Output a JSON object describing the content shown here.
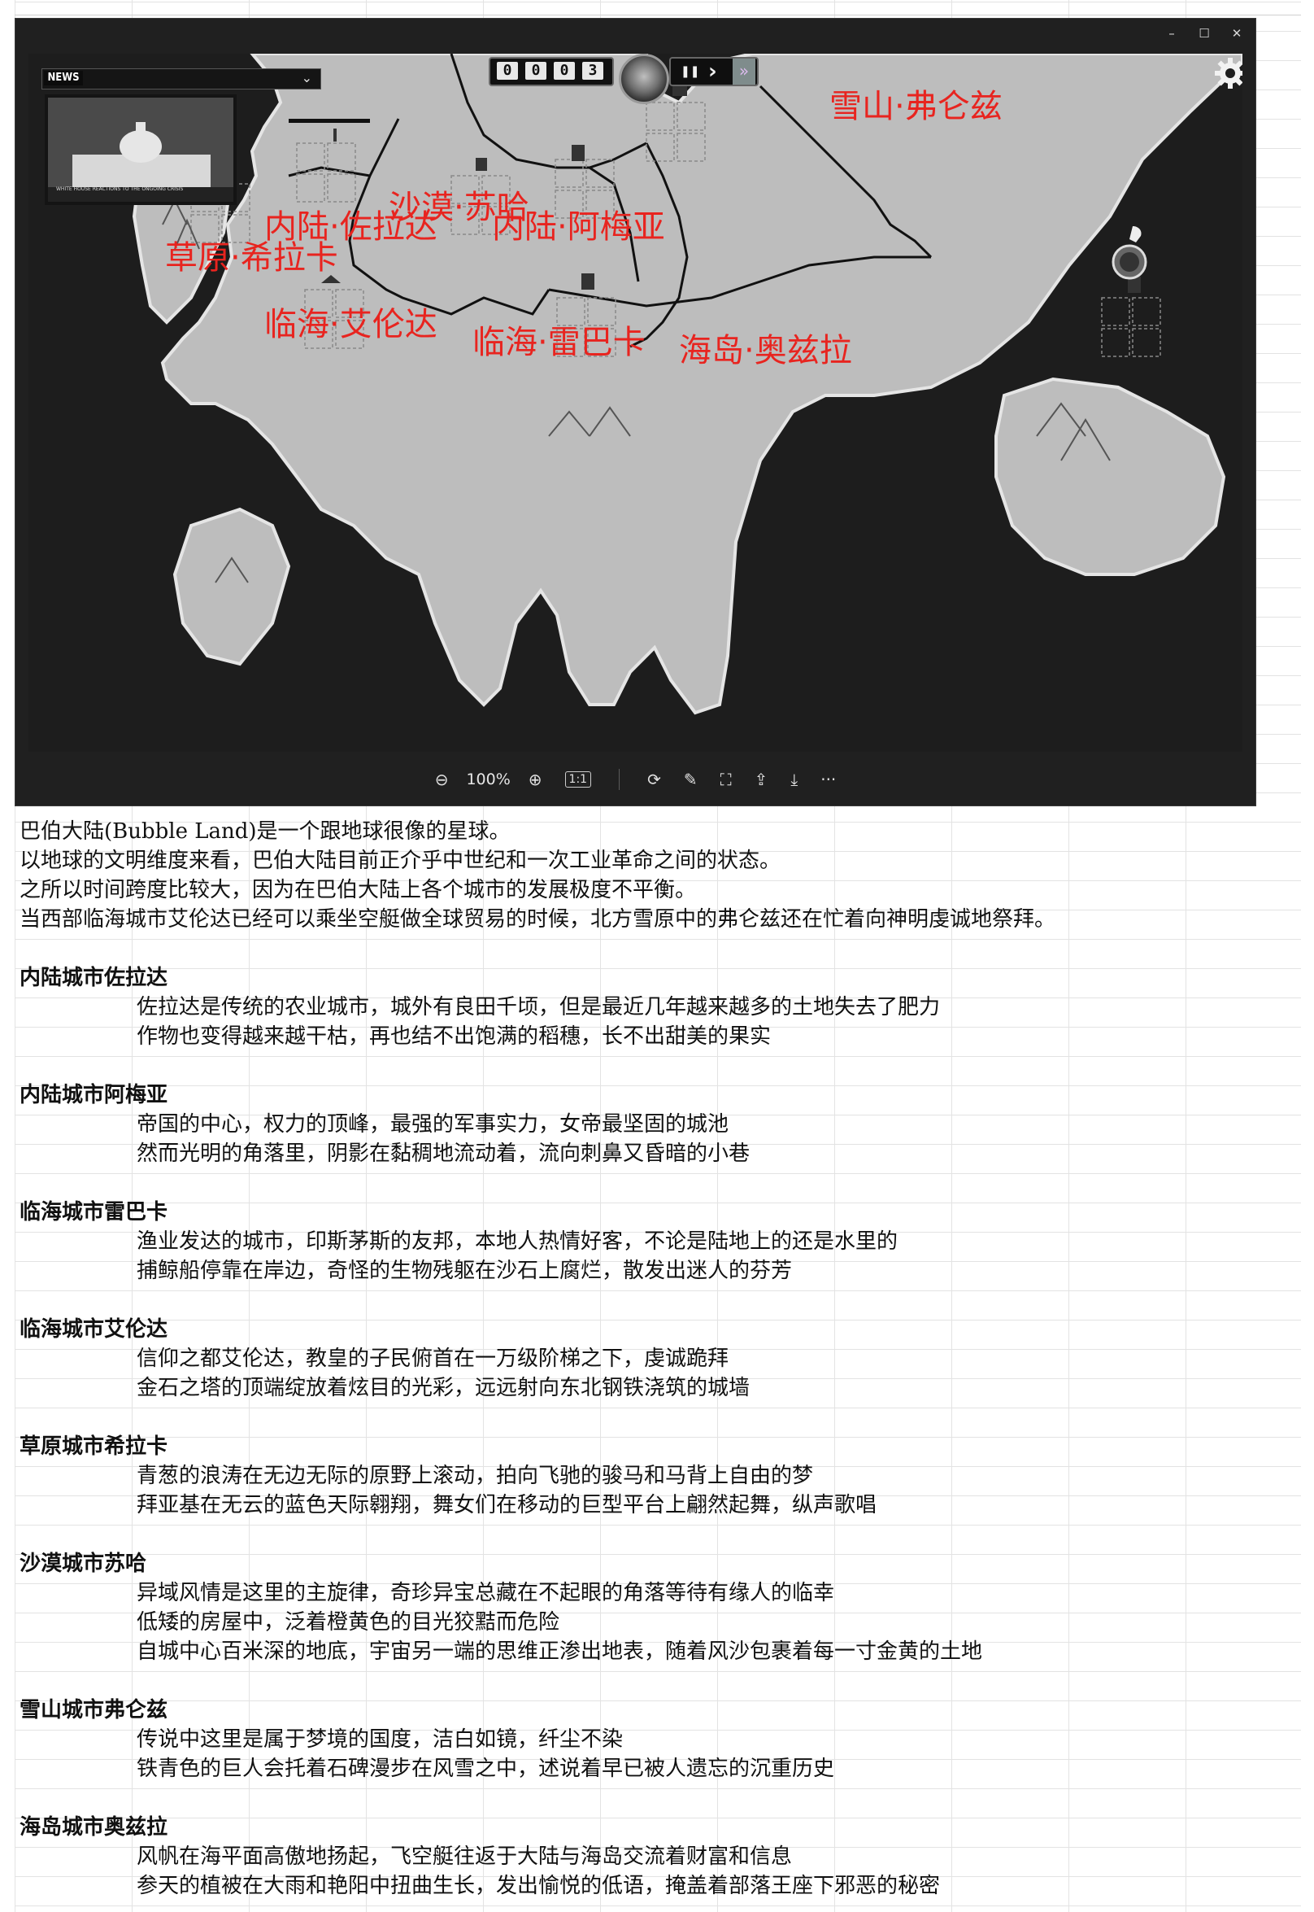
{
  "window": {
    "controls": {
      "minimize": "–",
      "maximize": "☐",
      "close": "✕"
    }
  },
  "news": {
    "tag": "NEWS",
    "caption": "WHITE HOUSE REACTIONS TO THE ONGOING CRISIS"
  },
  "hud": {
    "counter": [
      "0",
      "0",
      "0",
      "3"
    ],
    "pause": "❚❚",
    "play": "›",
    "speed": "»"
  },
  "map_labels": {
    "fulunzi": "雪山·弗仑兹",
    "zuolada": "内陆·佐拉达",
    "suha": "沙漠·苏哈",
    "ameiya": "内陆·阿梅亚",
    "xilaka": "草原·希拉卡",
    "ailunda": "临海·艾伦达",
    "leibaka": "临海·雷巴卡",
    "aozila": "海岛·奥兹拉"
  },
  "toolbar": {
    "zoom_out": "⊖",
    "zoom_value": "100%",
    "zoom_in": "⊕",
    "actual_size": "1:1",
    "rotate": "⟳",
    "edit": "✎",
    "crop": "⛶",
    "share": "⇪",
    "save": "⤓",
    "more": "···"
  },
  "doc": {
    "intro": [
      "巴伯大陆(Bubble Land)是一个跟地球很像的星球。",
      "以地球的文明维度来看，巴伯大陆目前正介乎中世纪和一次工业革命之间的状态。",
      "之所以时间跨度比较大，因为在巴伯大陆上各个城市的发展极度不平衡。",
      "当西部临海城市艾伦达已经可以乘坐空艇做全球贸易的时候，北方雪原中的弗仑兹还在忙着向神明虔诚地祭拜。"
    ],
    "sections": [
      {
        "title": "内陆城市佐拉达",
        "lines": [
          "佐拉达是传统的农业城市，城外有良田千顷，但是最近几年越来越多的土地失去了肥力",
          "作物也变得越来越干枯，再也结不出饱满的稻穗，长不出甜美的果实"
        ]
      },
      {
        "title": "内陆城市阿梅亚",
        "lines": [
          "帝国的中心，权力的顶峰，最强的军事实力，女帝最坚固的城池",
          "然而光明的角落里，阴影在黏稠地流动着，流向刺鼻又昏暗的小巷"
        ]
      },
      {
        "title": "临海城市雷巴卡",
        "lines": [
          "渔业发达的城市，印斯茅斯的友邦，本地人热情好客，不论是陆地上的还是水里的",
          "捕鲸船停靠在岸边，奇怪的生物残躯在沙石上腐烂，散发出迷人的芬芳"
        ]
      },
      {
        "title": "临海城市艾伦达",
        "lines": [
          "信仰之都艾伦达，教皇的子民俯首在一万级阶梯之下，虔诚跪拜",
          "金石之塔的顶端绽放着炫目的光彩，远远射向东北钢铁浇筑的城墙"
        ]
      },
      {
        "title": "草原城市希拉卡",
        "lines": [
          "青葱的浪涛在无边无际的原野上滚动，拍向飞驰的骏马和马背上自由的梦",
          "拜亚基在无云的蓝色天际翱翔，舞女们在移动的巨型平台上翩然起舞，纵声歌唱"
        ]
      },
      {
        "title": "沙漠城市苏哈",
        "lines": [
          "异域风情是这里的主旋律，奇珍异宝总藏在不起眼的角落等待有缘人的临幸",
          "低矮的房屋中，泛着橙黄色的目光狡黠而危险",
          "自城中心百米深的地底，宇宙另一端的思维正渗出地表，随着风沙包裹着每一寸金黄的土地"
        ]
      },
      {
        "title": "雪山城市弗仑兹",
        "lines": [
          "传说中这里是属于梦境的国度，洁白如镜，纤尘不染",
          "铁青色的巨人会托着石碑漫步在风雪之中，述说着早已被人遗忘的沉重历史"
        ]
      },
      {
        "title": "海岛城市奥兹拉",
        "lines": [
          "风帆在海平面高傲地扬起，飞空艇往返于大陆与海岛交流着财富和信息",
          "参天的植被在大雨和艳阳中扭曲生长，发出愉悦的低语，掩盖着部落王座下邪恶的秘密"
        ]
      }
    ]
  }
}
